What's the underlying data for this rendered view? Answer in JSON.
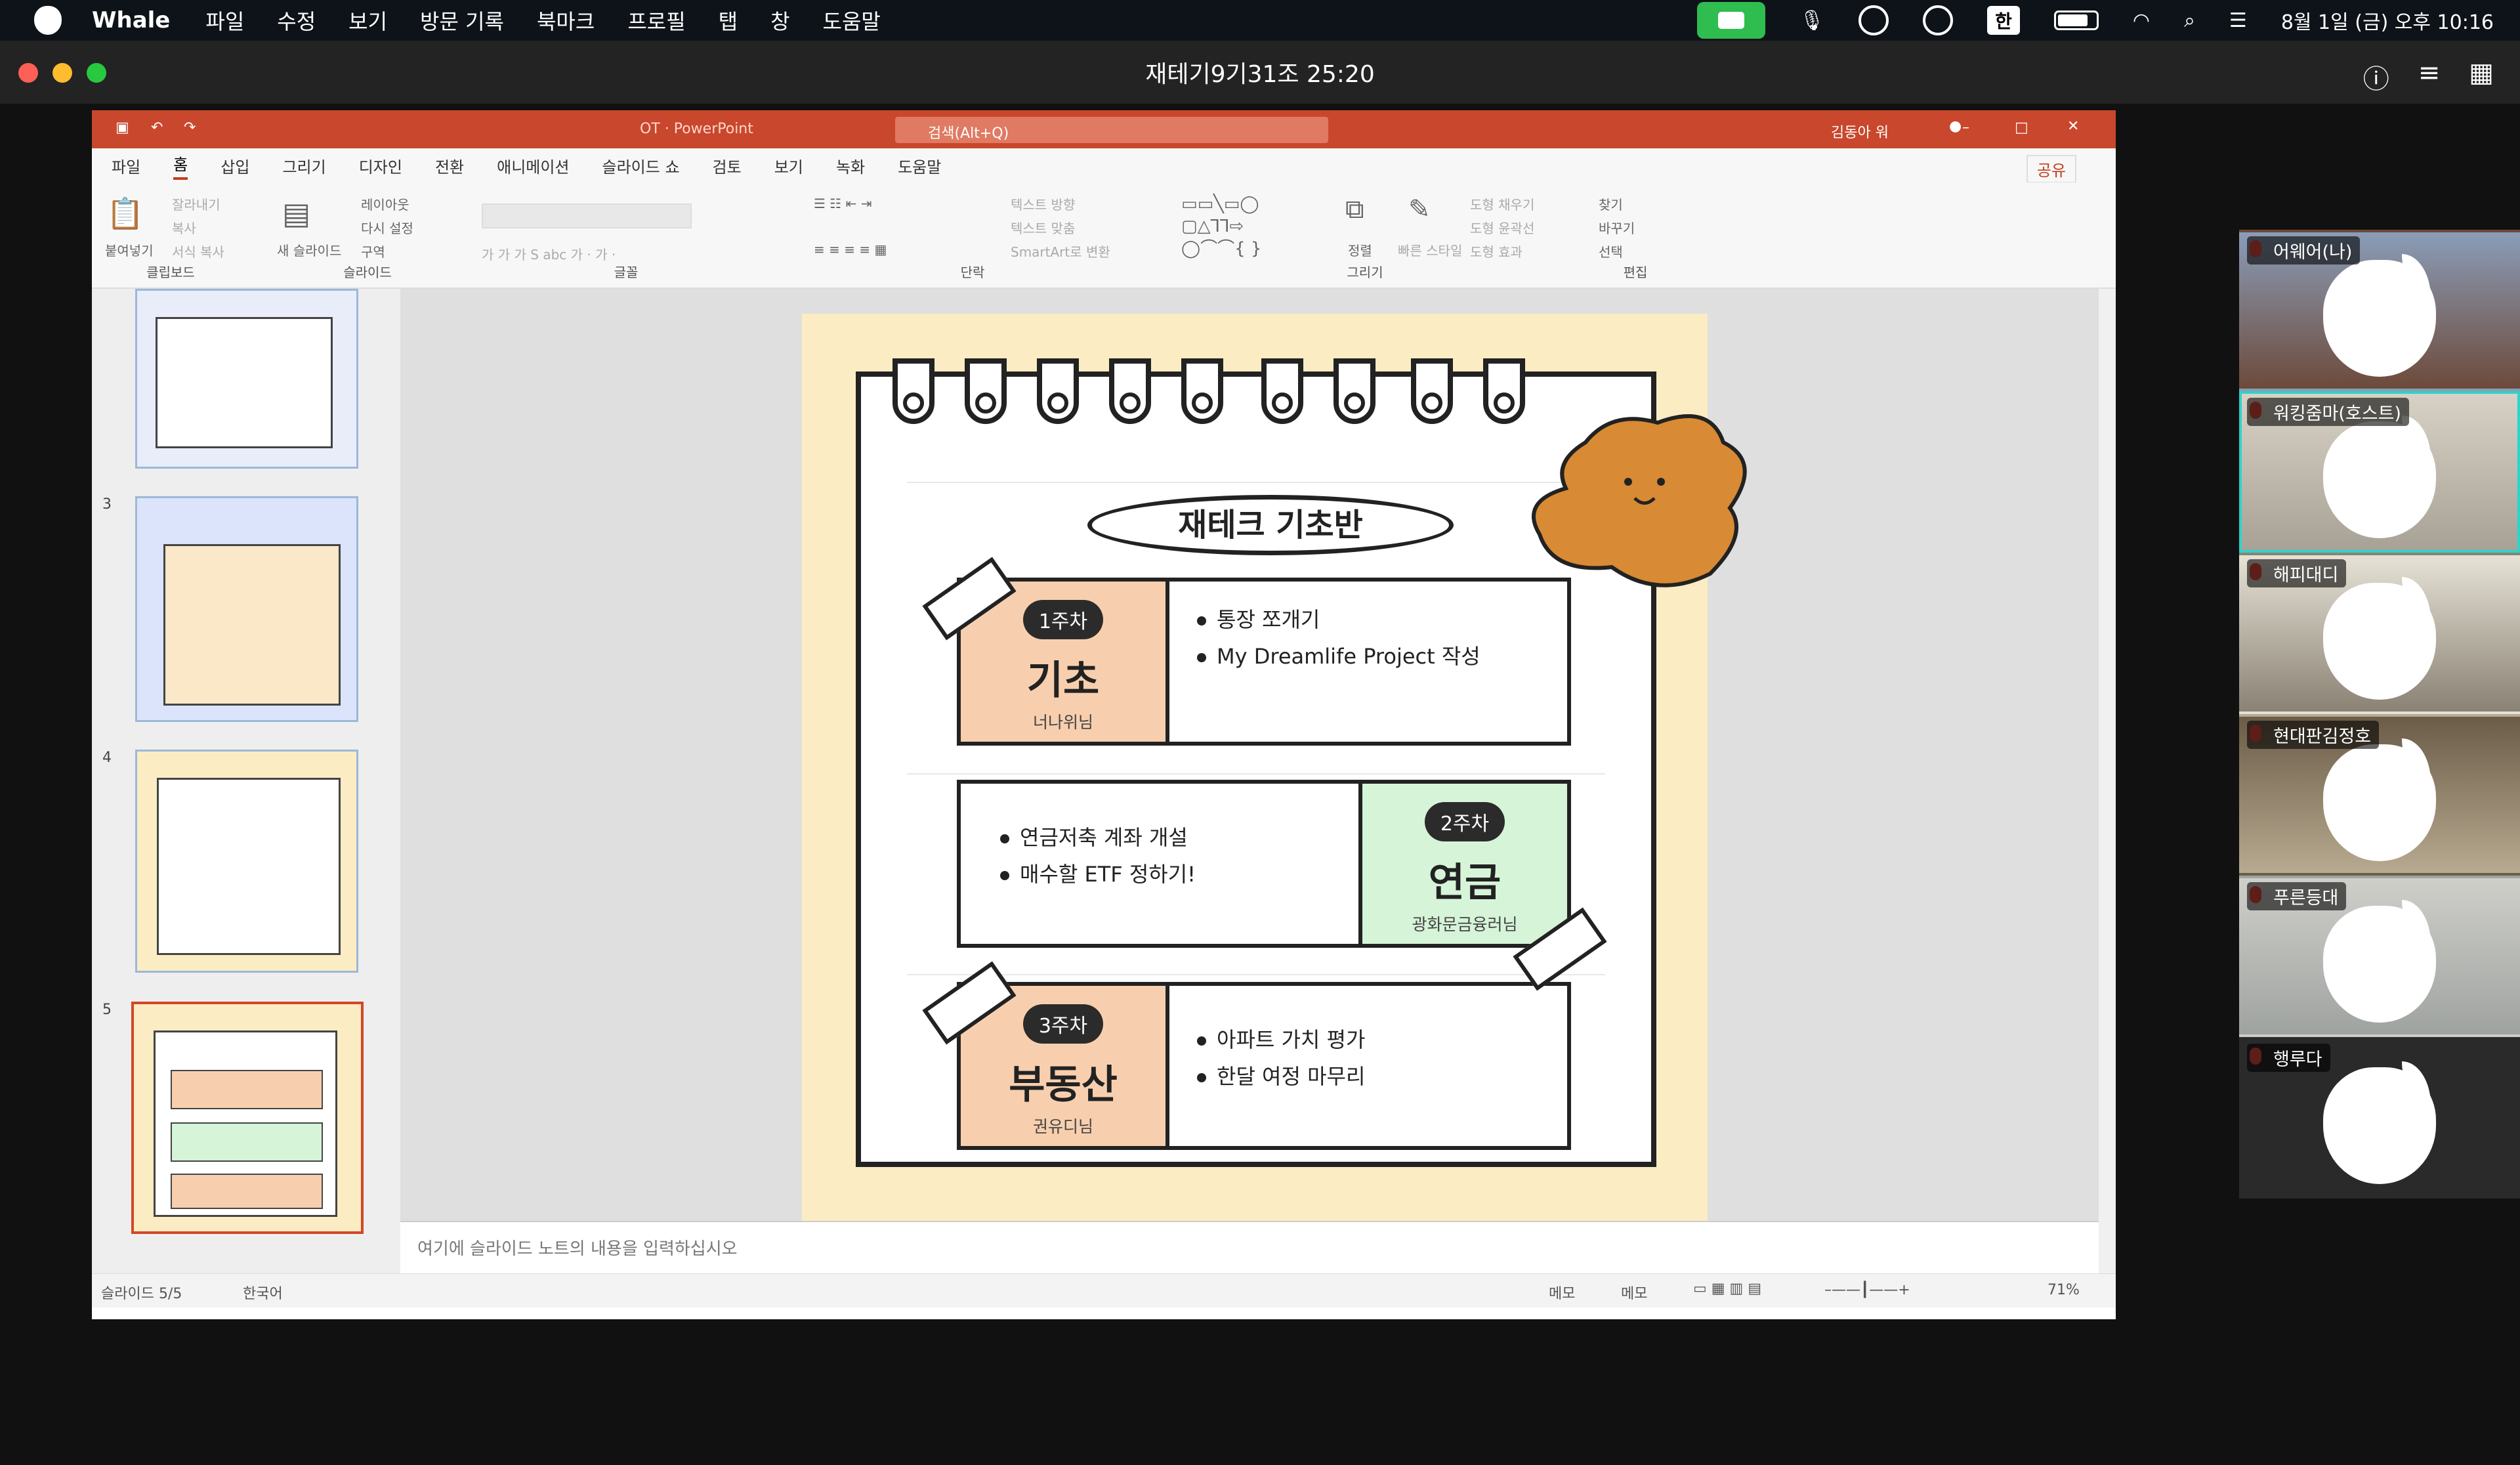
{
  "menubar": {
    "app": "Whale",
    "items": [
      "파일",
      "수정",
      "보기",
      "방문 기록",
      "북마크",
      "프로필",
      "탭",
      "창",
      "도움말"
    ],
    "ime": "한",
    "datetime": "8월 1일 (금) 오후 10:16"
  },
  "meeting": {
    "title": "재테기9기31조 25:20"
  },
  "ppt": {
    "filename": "OT  ·  PowerPoint",
    "search_placeholder": "검색(Alt+Q)",
    "user": "김동아 워",
    "tabs": [
      "파일",
      "홈",
      "삽입",
      "그리기",
      "디자인",
      "전환",
      "애니메이션",
      "슬라이드 쇼",
      "검토",
      "보기",
      "녹화",
      "도움말"
    ],
    "share": "공유",
    "groups": [
      "클립보드",
      "슬라이드",
      "글꼴",
      "단락",
      "그리기",
      "편집"
    ],
    "ribbon": {
      "paste": "붙여넣기",
      "cut": "잘라내기",
      "copy": "복사",
      "format": "서식 복사",
      "new_slide": "새 슬라이드",
      "layout": "레이아웃",
      "reset": "다시 설정",
      "section": "구역",
      "text_dir": "텍스트 방향",
      "align_text": "텍스트 맞춤",
      "smartart": "SmartArt로 변환",
      "arrange": "정렬",
      "quick_style": "빠른 스타일",
      "fill": "도형 채우기",
      "outline": "도형 윤곽선",
      "effects": "도형 효과",
      "find": "찾기",
      "replace": "바꾸기",
      "select": "선택"
    },
    "thumbs": [
      "3",
      "4",
      "5"
    ],
    "notes_placeholder": "여기에 슬라이드 노트의 내용을 입력하십시오",
    "status": {
      "slide": "슬라이드 5/5",
      "lang": "한국어",
      "notes": "메모",
      "comments": "메모",
      "zoom": "71%"
    }
  },
  "slide": {
    "title": "재테크 기초반",
    "weeks": [
      {
        "badge": "1주차",
        "name": "기초",
        "tutor": "너나위님",
        "bullets": [
          "통장 쪼개기",
          "My Dreamlife Project 작성"
        ]
      },
      {
        "badge": "2주차",
        "name": "연금",
        "tutor": "광화문금융러님",
        "bullets": [
          "연금저축 계좌 개설",
          "매수할 ETF 정하기!"
        ]
      },
      {
        "badge": "3주차",
        "name": "부동산",
        "tutor": "권유디님",
        "bullets": [
          "아파트 가치 평가",
          "한달 여정 마무리"
        ]
      }
    ]
  },
  "participants": [
    {
      "name": "어웨어(나)",
      "host": false
    },
    {
      "name": "워킹줌마(호스트)",
      "host": true
    },
    {
      "name": "해피대디",
      "host": false
    },
    {
      "name": "현대판김정호",
      "host": false
    },
    {
      "name": "푸른등대",
      "host": false
    },
    {
      "name": "행루다",
      "host": false
    }
  ]
}
